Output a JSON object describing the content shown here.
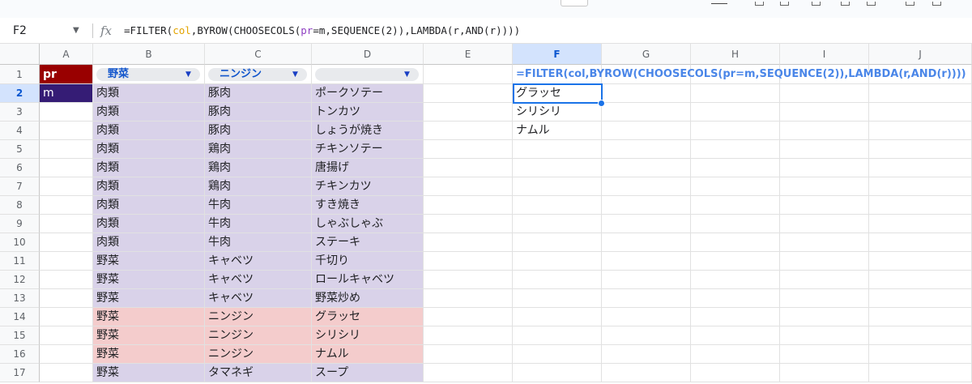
{
  "formula_bar": {
    "cell_ref": "F2",
    "fx_label": "fx",
    "formula_part1": "=FILTER(",
    "formula_col": "col",
    "formula_part2": ",BYROW(CHOOSECOLS(",
    "formula_pr": "pr",
    "formula_part3": "=",
    "formula_m": "m",
    "formula_part4": ",SEQUENCE(2)),LAMBDA(r,AND(r))))"
  },
  "columns": [
    "A",
    "B",
    "C",
    "D",
    "E",
    "F",
    "G",
    "H",
    "I",
    "J"
  ],
  "selected_column": "F",
  "rows": [
    "1",
    "2",
    "3",
    "4",
    "5",
    "6",
    "7",
    "8",
    "9",
    "10",
    "11",
    "12",
    "13",
    "14",
    "15",
    "16",
    "17"
  ],
  "selected_row": "2",
  "cells": {
    "a1": "pr",
    "a2": "m",
    "b1_chip": "野菜",
    "c1_chip": "ニンジン",
    "d1_chip": "",
    "f1_formula_text": "=FILTER(col,BYROW(CHOOSECOLS(pr=m,SEQUENCE(2)),LAMBDA(r,AND(r))))",
    "b_values": [
      "肉類",
      "肉類",
      "肉類",
      "肉類",
      "肉類",
      "肉類",
      "肉類",
      "肉類",
      "肉類",
      "野菜",
      "野菜",
      "野菜",
      "野菜",
      "野菜",
      "野菜",
      "野菜"
    ],
    "c_values": [
      "豚肉",
      "豚肉",
      "豚肉",
      "鶏肉",
      "鶏肉",
      "鶏肉",
      "牛肉",
      "牛肉",
      "牛肉",
      "キャベツ",
      "キャベツ",
      "キャベツ",
      "ニンジン",
      "ニンジン",
      "ニンジン",
      "タマネギ"
    ],
    "d_values": [
      "ポークソテー",
      "トンカツ",
      "しょうが焼き",
      "チキンソテー",
      "唐揚げ",
      "チキンカツ",
      "すき焼き",
      "しゃぶしゃぶ",
      "ステーキ",
      "千切り",
      "ロールキャベツ",
      "野菜炒め",
      "グラッセ",
      "シリシリ",
      "ナムル",
      "スープ"
    ],
    "f_values": [
      "グラッセ",
      "シリシリ",
      "ナムル"
    ]
  },
  "colors": {
    "a1_fill": "#990000",
    "a2_fill": "#351c75",
    "data_fill": "#d9d2e9",
    "match_fill": "#f4cccc",
    "selection": "#1a73e8",
    "spill_text": "#4a86e8"
  }
}
